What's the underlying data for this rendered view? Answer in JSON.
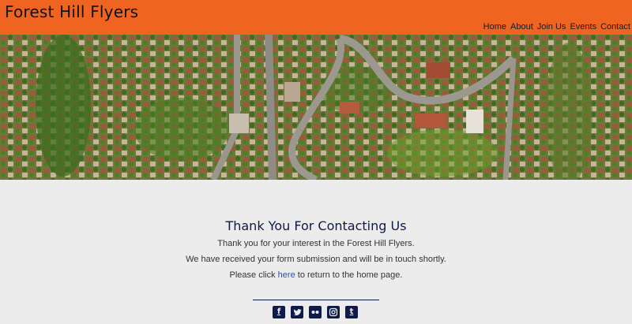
{
  "site": {
    "title": "Forest Hill Flyers",
    "accent": "#f06422",
    "text_dark": "#0f1a4a"
  },
  "nav": {
    "items": [
      {
        "label": "Home"
      },
      {
        "label": "About"
      },
      {
        "label": "Join Us"
      },
      {
        "label": "Events"
      },
      {
        "label": "Contact"
      }
    ]
  },
  "hero": {
    "icon": "aerial-photo"
  },
  "thankyou": {
    "heading": "Thank You For Contacting Us",
    "line1": "Thank you for your interest in the Forest Hill Flyers.",
    "line2": "We have received your form submission and will be in touch shortly.",
    "line3_prefix": "Please click ",
    "line3_link": "here",
    "line3_suffix": " to return to the home page."
  },
  "social": {
    "icons": [
      "facebook-icon",
      "twitter-icon",
      "flickr-icon",
      "instagram-icon",
      "tumblr-icon"
    ]
  }
}
